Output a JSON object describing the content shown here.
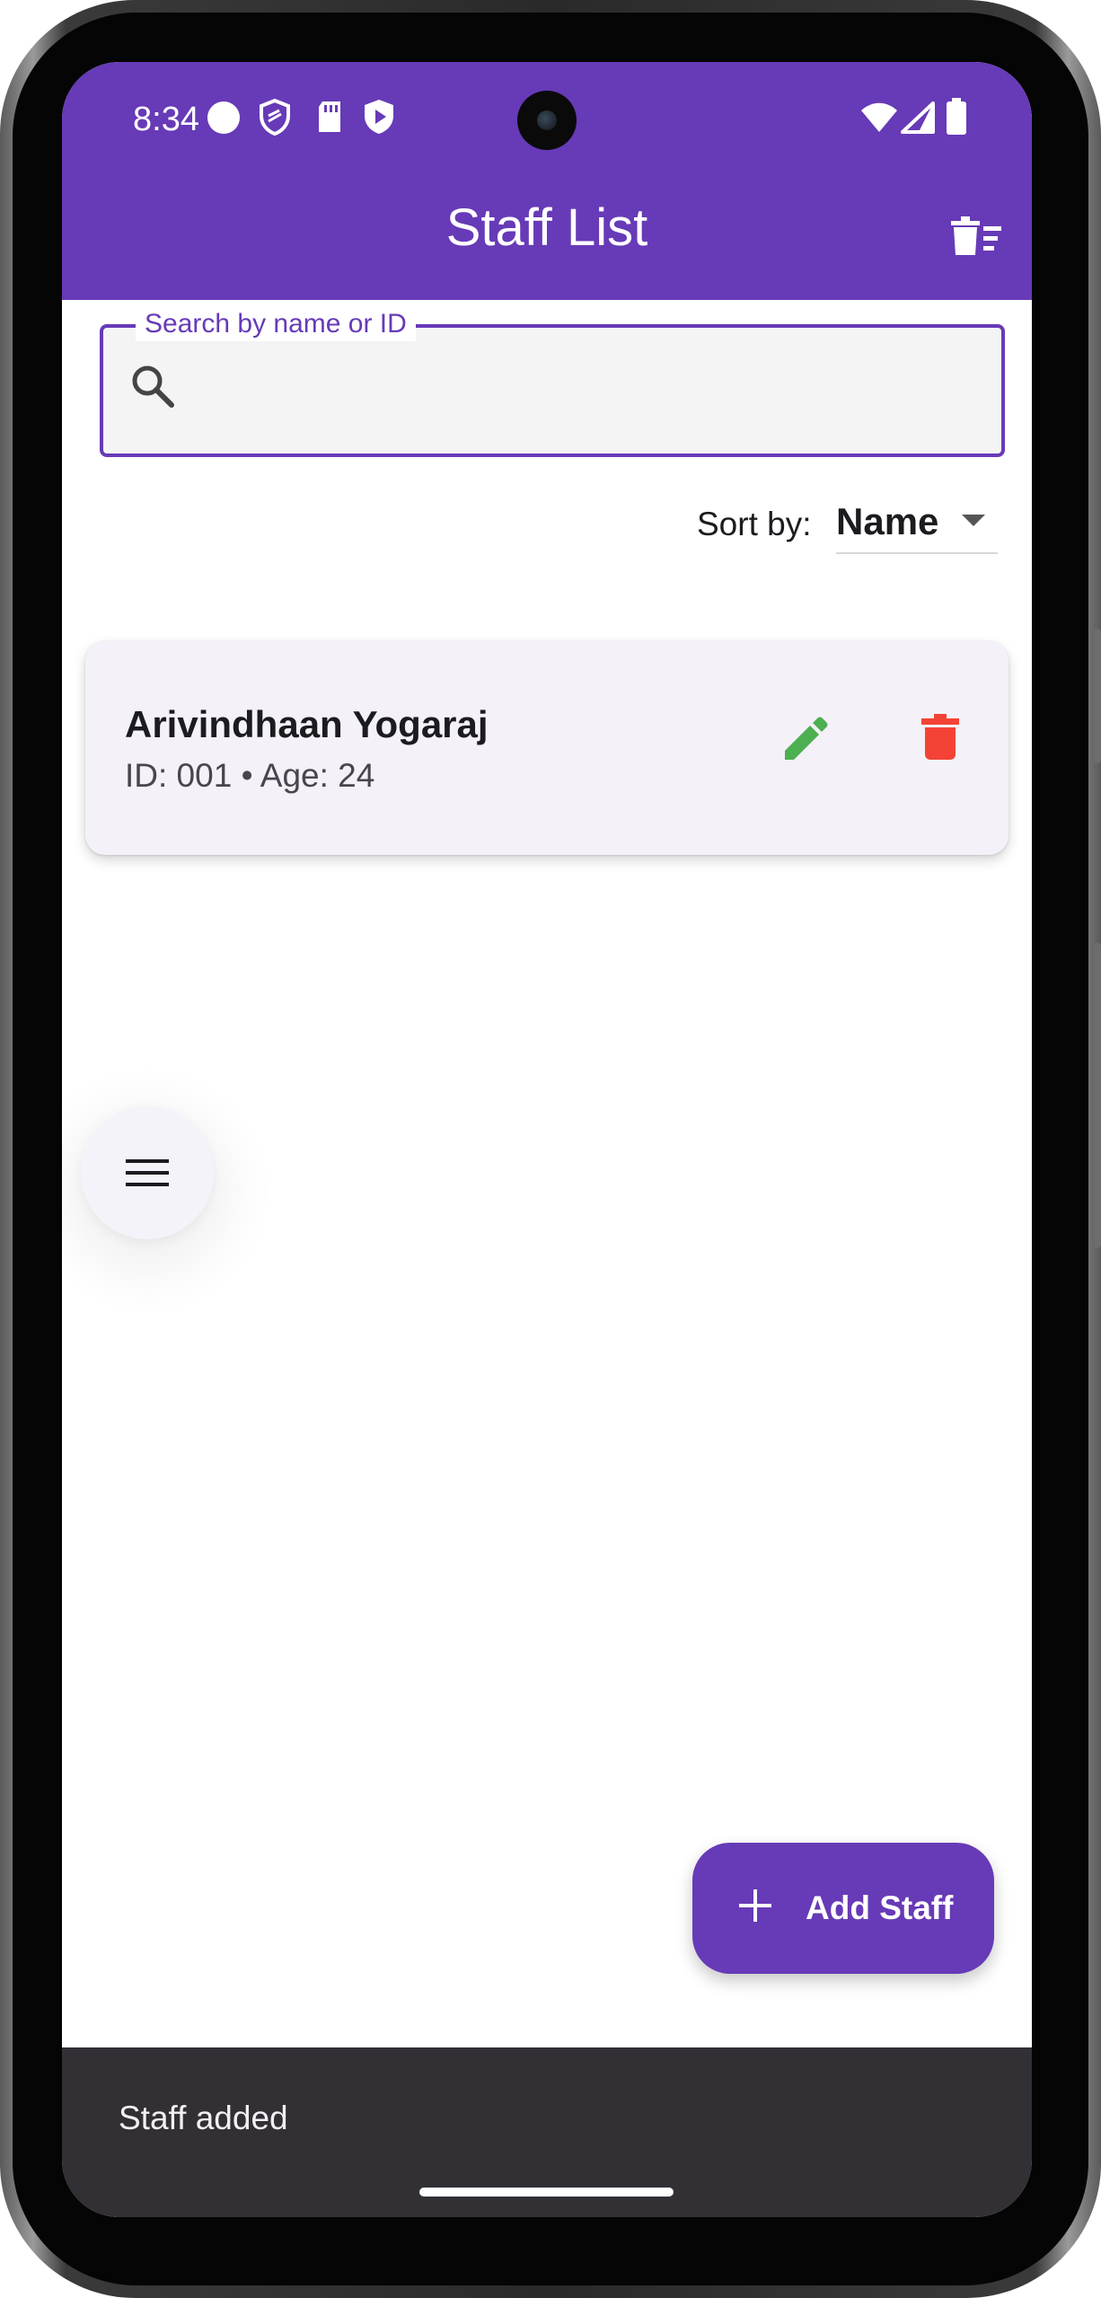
{
  "status_bar": {
    "time": "8:34",
    "left_icons": [
      "circle-notification-icon",
      "shield-icon",
      "sd-card-icon",
      "play-protect-icon"
    ],
    "right_icons": [
      "wifi-icon",
      "signal-icon",
      "battery-icon"
    ]
  },
  "app_bar": {
    "title": "Staff List",
    "action_icon": "delete-sweep-icon",
    "color": "#673ab7"
  },
  "search": {
    "label": "Search by name or ID",
    "value": "",
    "icon": "search-icon"
  },
  "sort": {
    "label": "Sort by:",
    "selected": "Name"
  },
  "staff": [
    {
      "name": "Arivindhaan Yogaraj",
      "meta": "ID: 001 • Age: 24",
      "edit_icon_color": "#4caf50",
      "delete_icon_color": "#f44336"
    }
  ],
  "menu_fab": {
    "icon": "menu-icon"
  },
  "add_fab": {
    "label": "Add Staff",
    "icon": "plus-icon"
  },
  "snackbar": {
    "message": "Staff added"
  }
}
